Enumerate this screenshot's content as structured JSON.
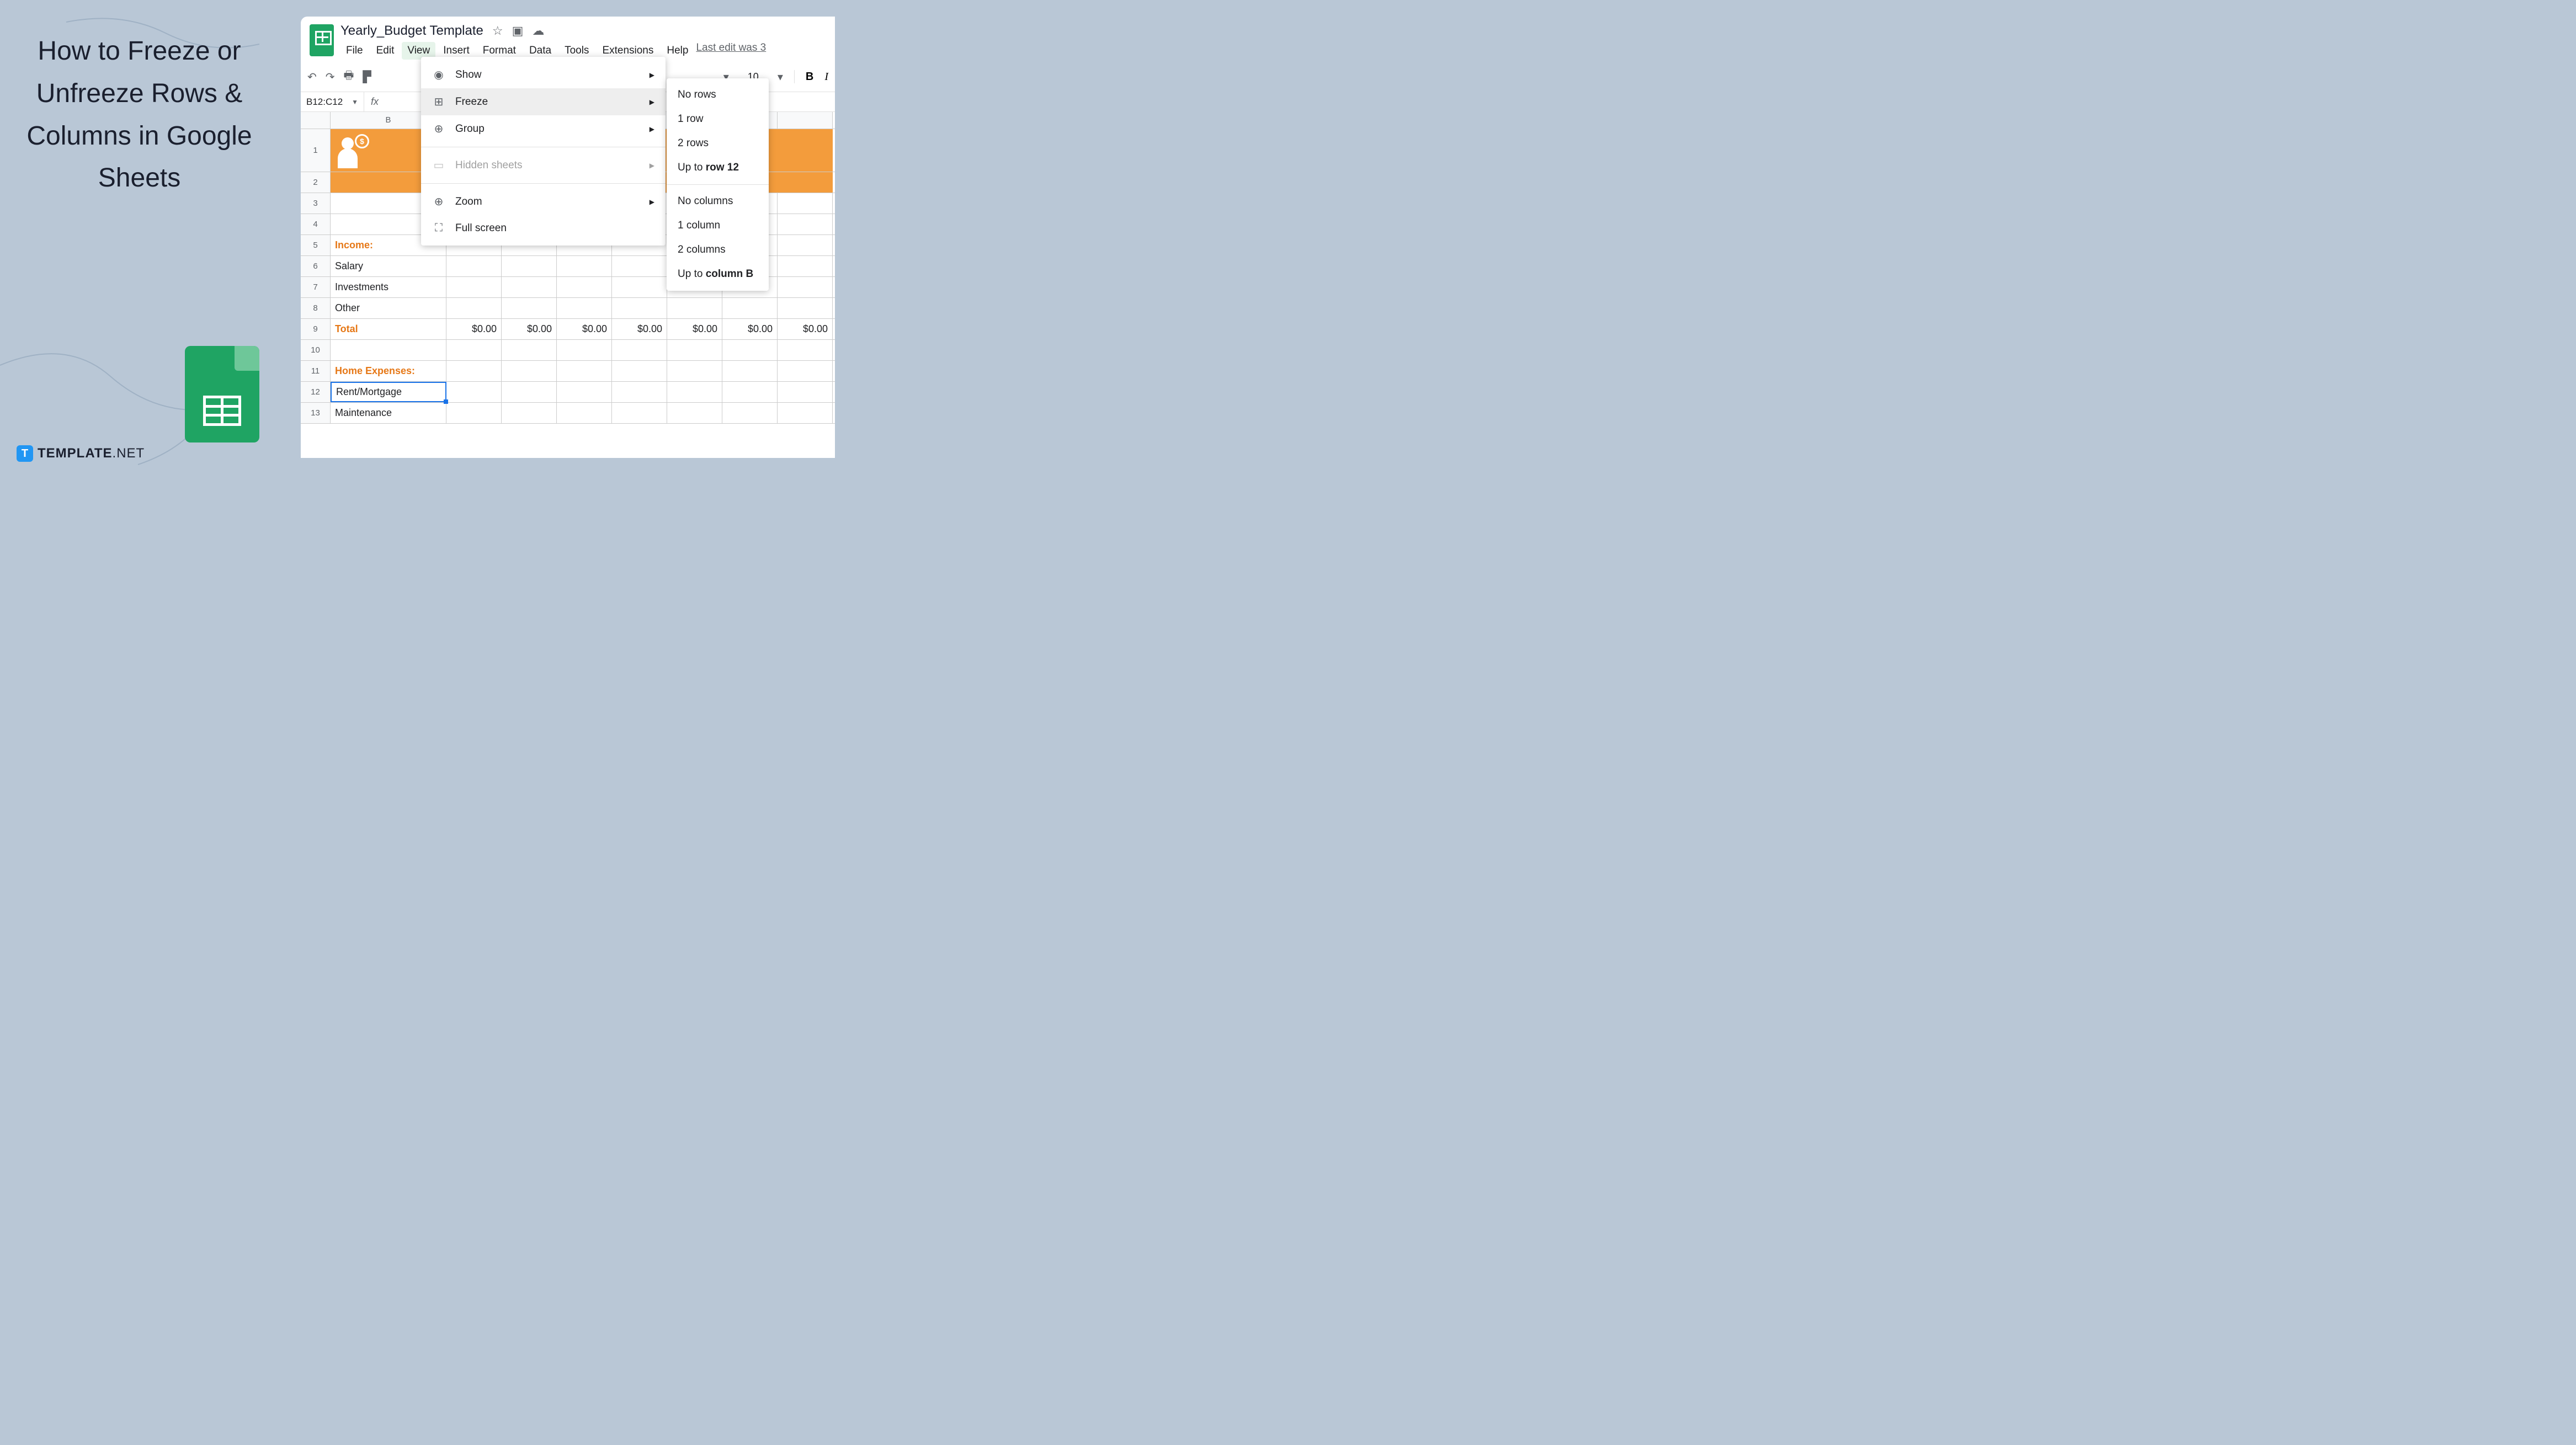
{
  "left": {
    "title": "How to Freeze or Unfreeze Rows & Columns in Google Sheets",
    "brand1": "TEMPLATE",
    "brand2": ".NET",
    "brand_icon": "T"
  },
  "app": {
    "doc_title": "Yearly_Budget Template",
    "menus": [
      "File",
      "Edit",
      "View",
      "Insert",
      "Format",
      "Data",
      "Tools",
      "Extensions",
      "Help"
    ],
    "last_edit": "Last edit was 3",
    "name_box": "B12:C12",
    "fx_label": "fx",
    "font_size": "10",
    "col_headers": [
      "B"
    ],
    "row_numbers": [
      "1",
      "2",
      "3",
      "4",
      "5",
      "6",
      "7",
      "8",
      "9",
      "10",
      "11",
      "12",
      "13"
    ],
    "cells": {
      "income": "Income:",
      "salary": "Salary",
      "investments": "Investments",
      "other": "Other",
      "total": "Total",
      "home_exp": "Home Expenses:",
      "rent": "Rent/Mortgage",
      "maintenance": "Maintenance",
      "dollar": "$0.00"
    }
  },
  "view_menu": {
    "show": "Show",
    "freeze": "Freeze",
    "group": "Group",
    "hidden": "Hidden sheets",
    "zoom": "Zoom",
    "fullscreen": "Full screen"
  },
  "freeze_submenu": {
    "no_rows": "No rows",
    "row1": "1 row",
    "row2": "2 rows",
    "up_row_pre": "Up to ",
    "up_row_bold": "row 12",
    "no_cols": "No columns",
    "col1": "1 column",
    "col2": "2 columns",
    "up_col_pre": "Up to ",
    "up_col_bold": "column B"
  }
}
